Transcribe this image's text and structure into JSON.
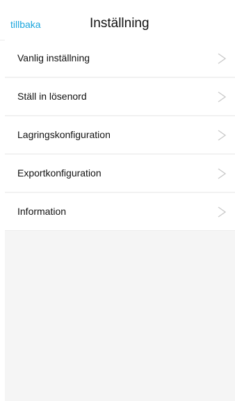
{
  "header": {
    "back_label": "tillbaka",
    "title": "Inställning"
  },
  "settings": {
    "items": [
      {
        "label": "Vanlig inställning"
      },
      {
        "label": "Ställ in lösenord"
      },
      {
        "label": "Lagringskonfiguration"
      },
      {
        "label": "Exportkonfiguration"
      },
      {
        "label": "Information"
      }
    ]
  },
  "colors": {
    "accent": "#1aa6dd",
    "text": "#111111",
    "chevron": "#c8c8c8",
    "background": "#f5f5f5"
  },
  "icons": {
    "row_arrow": "chevron-right-icon"
  }
}
